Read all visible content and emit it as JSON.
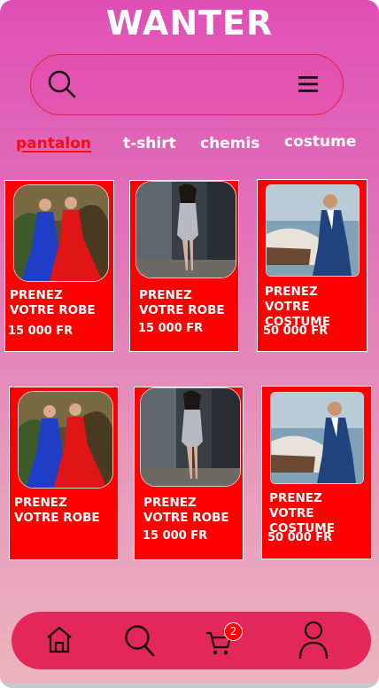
{
  "app": {
    "title": "WANTER"
  },
  "search": {
    "placeholder": ""
  },
  "categories": [
    {
      "label": "pantalon",
      "active": true
    },
    {
      "label": "t-shirt",
      "active": false
    },
    {
      "label": "chemis",
      "active": false
    },
    {
      "label": "costume",
      "active": false
    }
  ],
  "products": [
    {
      "title": "PRENEZ VOTRE ROBE",
      "price": "15 000 FR",
      "image": "two-women-evening-gowns"
    },
    {
      "title": "PRENEZ VOTRE ROBE",
      "price": "15 000 FR",
      "image": "woman-sequin-dress"
    },
    {
      "title": "PRENEZ VOTRE COSTUME",
      "price": "50 000 FR",
      "image": "man-blue-suit-boat"
    },
    {
      "title": "PRENEZ VOTRE ROBE",
      "price": "",
      "image": "two-women-evening-gowns"
    },
    {
      "title": "PRENEZ VOTRE ROBE",
      "price": "15 000 FR",
      "image": "woman-sequin-dress"
    },
    {
      "title": "PRENEZ VOTRE COSTUME",
      "price": "50 000 FR",
      "image": "man-blue-suit-boat"
    }
  ],
  "nav": {
    "items": [
      "home-icon",
      "search-icon",
      "cart-icon",
      "user-icon"
    ],
    "cart_count": "2"
  },
  "colors": {
    "card": "#ff0000",
    "accent": "#e32859",
    "active_category": "#ff0a0a"
  }
}
